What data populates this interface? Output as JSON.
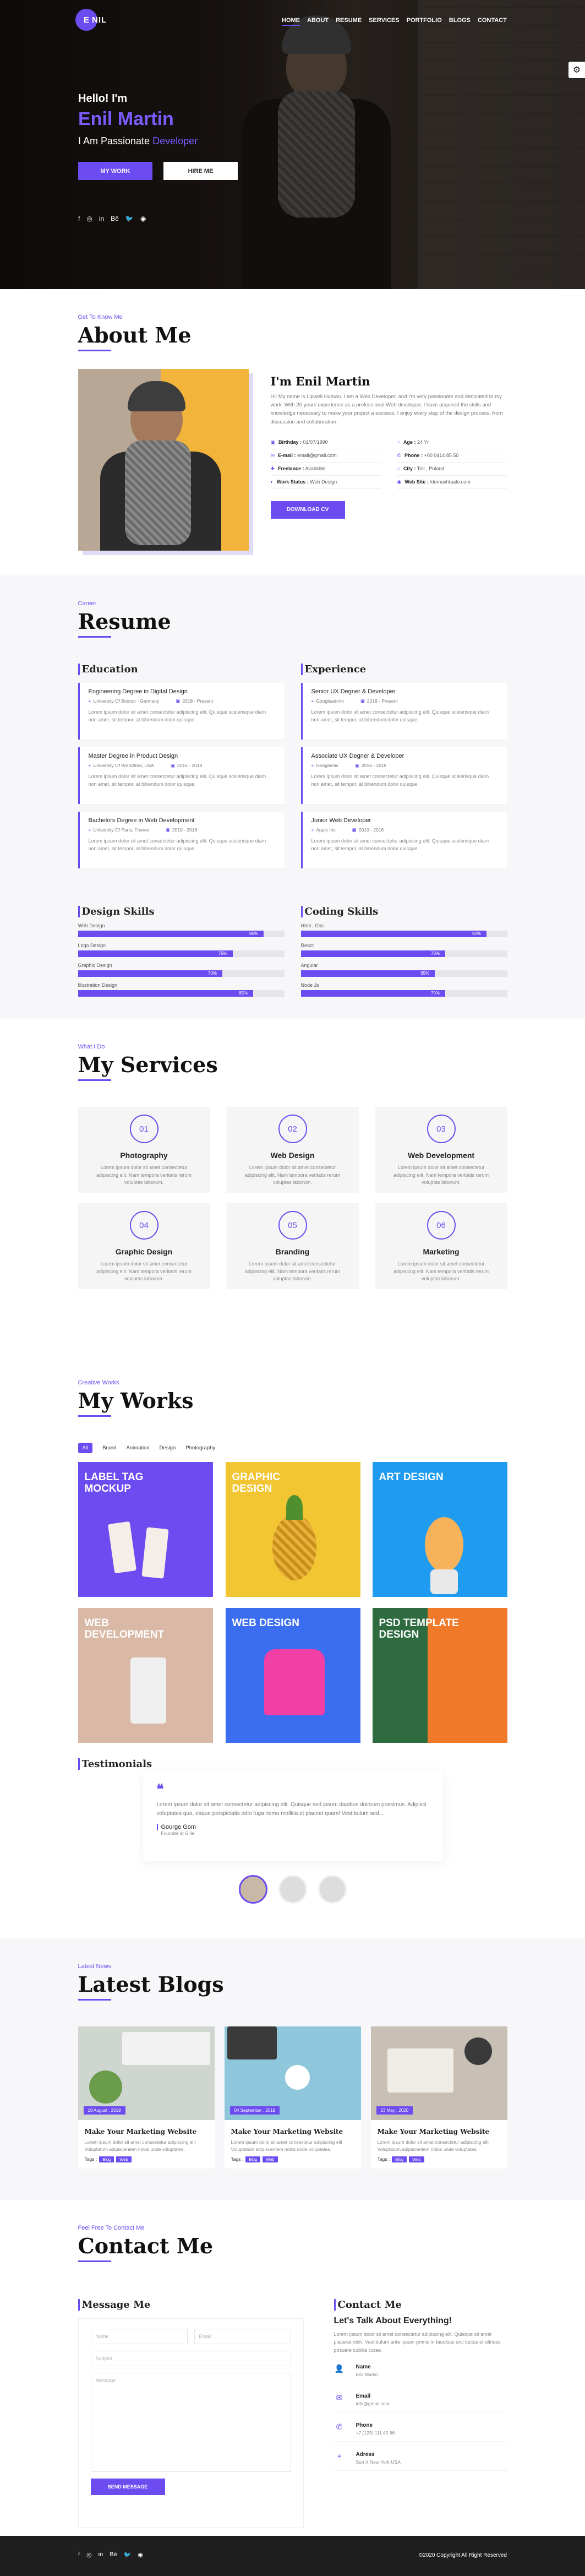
{
  "nav": {
    "logo_mark": "E",
    "logo_rest": "NIL",
    "items": [
      "HOME",
      "ABOUT",
      "RESUME",
      "SERVICES",
      "PORTFOLIO",
      "BLOGS",
      "CONTACT"
    ]
  },
  "hero": {
    "hello": "Hello! I'm",
    "name": "Enil Martin",
    "tagline": "I Am Passionate",
    "tagline_accent": "Developer",
    "btn_primary": "MY WORK",
    "btn_secondary": "HIRE ME",
    "socials": [
      "f",
      "◎",
      "in",
      "Bē",
      "🐦",
      "◉"
    ]
  },
  "about": {
    "kicker": "Get To Know Me",
    "title": "About Me",
    "name": "I'm Enil Martin",
    "bio": "Hi! My name is Lipwell Human. I am a Web Developer, and I'm very passionate and dedicated to my work. With 20 years experience as a professional Web developer, I have acquired the skills and knowledge necessary to make your project a success. I enjoy every step of the design process, from discussion and collaboration.",
    "facts": [
      {
        "icon": "▣",
        "label": "Birthday :",
        "value": "01/07/1990"
      },
      {
        "icon": "◔",
        "label": "Age :",
        "value": "24 Yr"
      },
      {
        "icon": "✉",
        "label": "E-mail :",
        "value": "email@gmail.com"
      },
      {
        "icon": "✆",
        "label": "Phone :",
        "value": "+00 0414 85 50"
      },
      {
        "icon": "✚",
        "label": "Freelance :",
        "value": "Available"
      },
      {
        "icon": "⌂",
        "label": "City :",
        "value": "Toit , Poland"
      },
      {
        "icon": "◐",
        "label": "Work Status :",
        "value": "Web Design"
      },
      {
        "icon": "◉",
        "label": "Web Site :",
        "value": "/demoxhtaalo.com"
      }
    ],
    "download": "DOWNLOAD CV"
  },
  "resume": {
    "kicker": "Career",
    "title": "Resume",
    "education_title": "Education",
    "experience_title": "Experience",
    "education": [
      {
        "title": "Engineering Degree in Digital Design",
        "place": "University Of Boston - Germany",
        "years": "2018 - Present",
        "desc": "Lorem ipsum dolor sit amet consectetur adipiscing elit. Quisque scelerisque diam non amet, sit tempor, at bibendum dolor quisque."
      },
      {
        "title": "Master Degree in Product Design",
        "place": "University Of Brandford, USA",
        "years": "2016 - 2018",
        "desc": "Lorem ipsum dolor sit amet consectetur adipiscing elit. Quisque scelerisque diam non amet, sit tempor, at bibendum dolor quisque."
      },
      {
        "title": "Bachelors Degree in Web Development",
        "place": "University Of Paris, France",
        "years": "2010 - 2016",
        "desc": "Lorem ipsum dolor sit amet consectetur adipiscing elit. Quisque scelerisque diam non amet, sit tempor, at bibendum dolor quisque."
      }
    ],
    "experience": [
      {
        "title": "Senior UX Degner & Developer",
        "place": "Googleadmin",
        "years": "2018 - Present",
        "desc": "Lorem ipsum dolor sit amet consectetur adipiscing elit. Quisque scelerisque diam non amet, sit tempor, at bibendum dolor quisque."
      },
      {
        "title": "Associate UX Degner & Developer",
        "place": "Googlemic",
        "years": "2016 - 2018",
        "desc": "Lorem ipsum dolor sit amet consectetur adipiscing elit. Quisque scelerisque diam non amet, sit tempor, at bibendum dolor quisque."
      },
      {
        "title": "Junior Web Developer",
        "place": "Apple Inc",
        "years": "2010 - 2016",
        "desc": "Lorem ipsum dolor sit amet consectetur adipiscing elit. Quisque scelerisque diam non amet, sit tempor, at bibendum dolor quisque."
      }
    ],
    "design_skills_title": "Design Skills",
    "coding_skills_title": "Coding Skills",
    "design_skills": [
      {
        "name": "Web Design",
        "pct": "90%",
        "value": 0.9
      },
      {
        "name": "Logo Design",
        "pct": "75%",
        "value": 0.75
      },
      {
        "name": "Graphic Design",
        "pct": "70%",
        "value": 0.7
      },
      {
        "name": "Illustration Design",
        "pct": "85%",
        "value": 0.85
      }
    ],
    "coding_skills": [
      {
        "name": "Html , Css",
        "pct": "90%",
        "value": 0.9
      },
      {
        "name": "React",
        "pct": "70%",
        "value": 0.7
      },
      {
        "name": "Angular",
        "pct": "65%",
        "value": 0.65
      },
      {
        "name": "Node Js",
        "pct": "70%",
        "value": 0.7
      }
    ]
  },
  "services": {
    "kicker": "What I Do",
    "title": "My Services",
    "desc": "Lorem ipsum dolor sit amet consectetur adipiscing elit. Nam tempora veritatis rerum voluptas laborum.",
    "items": [
      {
        "num": "01",
        "title": "Photography"
      },
      {
        "num": "02",
        "title": "Web Design"
      },
      {
        "num": "03",
        "title": "Web Development"
      },
      {
        "num": "04",
        "title": "Graphic Design"
      },
      {
        "num": "05",
        "title": "Branding"
      },
      {
        "num": "06",
        "title": "Marketing"
      }
    ]
  },
  "works": {
    "kicker": "Creative Works",
    "title": "My Works",
    "filters": [
      "All",
      "Brand",
      "Animation",
      "Design",
      "Photography"
    ],
    "tiles": [
      {
        "caption": "LABEL TAG MOCKUP",
        "color": "#6c4cf0"
      },
      {
        "caption": "GRAPHIC DESIGN",
        "color": "#f2c533"
      },
      {
        "caption": "ART DESIGN",
        "color": "#1f9bf0"
      },
      {
        "caption": "WEB DEVELOPMENT",
        "color": "#d9b8a5"
      },
      {
        "caption": "WEB DESIGN",
        "color": "#3a6df0"
      },
      {
        "caption": "PSD TEMPLATE DESIGN",
        "color": "#f07a2a"
      }
    ],
    "testimonials_title": "Testimonials",
    "quote": "Lorem ipsum dolor sit amet consectetur adipiscing elit. Quisque sed ipsum dapibus dolorum possimus. Adipisci voluptates quo, eaque perspiciatis odio fuga nemo mollitia et placeat quam! Vestibulum sed...",
    "author": "Gourge Gom",
    "role": "Founder at Gilla"
  },
  "blogs": {
    "kicker": "Latest News",
    "title": "Latest Blogs",
    "posts": [
      {
        "date": "18 August , 2019",
        "title": "Make Your Marketing Website",
        "desc": "Lorem ipsum dolor sit amet consectetur adipiscing elit Voluptatum adipiscentem nobis unde voluptates.",
        "tags_label": "Tags :",
        "tags": [
          "Blog",
          "Web"
        ]
      },
      {
        "date": "04 September , 2019",
        "title": "Make Your Marketing Website",
        "desc": "Lorem ipsum dolor sit amet consectetur adipiscing elit Voluptatum adipiscentem nobis unde voluptates.",
        "tags_label": "Tags :",
        "tags": [
          "Blog",
          "Web"
        ]
      },
      {
        "date": "23 May , 2020",
        "title": "Make Your Marketing Website",
        "desc": "Lorem ipsum dolor sit amet consectetur adipiscing elit Voluptatum adipiscentem nobis unde voluptates.",
        "tags_label": "Tags :",
        "tags": [
          "Blog",
          "Web"
        ]
      }
    ]
  },
  "contact": {
    "kicker": "Feel Free To Contact Me",
    "title": "Contact Me",
    "message_title": "Message Me",
    "contact_title": "Contact Me",
    "name_ph": "Name",
    "email_ph": "Email",
    "subject_ph": "Subject",
    "message_ph": "Message",
    "send": "SEND MESSAGE",
    "heading": "Let's Talk About Everything!",
    "text": "Lorem ipsum dolor sit amet consectetur adipiscing elit. Quisque sit amet placerat nibh. Vestibulum ante ipsum primis in faucibus orci luctus et ultrices posuere cubilia curae.",
    "items": [
      {
        "icon": "👤",
        "label": "Name",
        "value": "Enil Martin"
      },
      {
        "icon": "✉",
        "label": "Email",
        "value": "info@gmail.com"
      },
      {
        "icon": "✆",
        "label": "Phone",
        "value": "+7 (123) 111 45 66"
      },
      {
        "icon": "⌖",
        "label": "Adress",
        "value": "Sun X New York USA"
      }
    ]
  },
  "footer": {
    "socials": [
      "f",
      "◎",
      "in",
      "Bē",
      "🐦",
      "◉"
    ],
    "copyright": "©2020 Copyright All Right Reserved"
  }
}
